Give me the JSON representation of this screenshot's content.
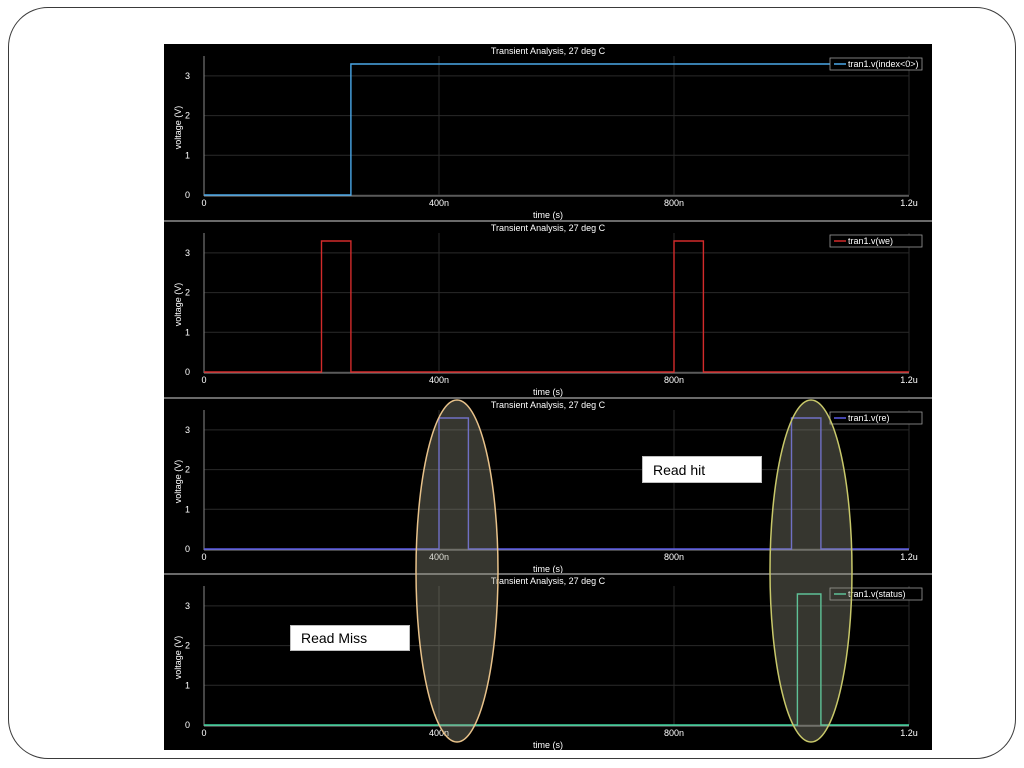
{
  "annotations": {
    "read_hit": "Read hit",
    "read_miss": "Read Miss"
  },
  "colors": {
    "background": "#000000",
    "grid": "#2a2a2a",
    "axis_text": "#ffffff",
    "highlight_outline": "#e8c28a",
    "highlight_fill": "#9a9a86"
  },
  "chart_data": [
    {
      "type": "line",
      "title": "Transient Analysis, 27 deg C",
      "xlabel": "time (s)",
      "ylabel": "voltage (V)",
      "xlim": [
        0,
        1200
      ],
      "ylim": [
        0,
        3.3
      ],
      "xticks": [
        {
          "v": 0,
          "l": "0"
        },
        {
          "v": 400,
          "l": "400n"
        },
        {
          "v": 800,
          "l": "800n"
        },
        {
          "v": 1200,
          "l": "1.2u"
        }
      ],
      "yticks": [
        0,
        1,
        2,
        3
      ],
      "legend_position": "top-right",
      "series": [
        {
          "name": "tran1.v(index<0>)",
          "color": "#4aa8e8",
          "x": [
            0,
            250,
            250,
            1200
          ],
          "y": [
            0,
            0,
            3.3,
            3.3
          ]
        }
      ]
    },
    {
      "type": "line",
      "title": "Transient Analysis, 27 deg C",
      "xlabel": "time (s)",
      "ylabel": "voltage (V)",
      "xlim": [
        0,
        1200
      ],
      "ylim": [
        0,
        3.3
      ],
      "xticks": [
        {
          "v": 0,
          "l": "0"
        },
        {
          "v": 400,
          "l": "400n"
        },
        {
          "v": 800,
          "l": "800n"
        },
        {
          "v": 1200,
          "l": "1.2u"
        }
      ],
      "yticks": [
        0,
        1,
        2,
        3
      ],
      "legend_position": "top-right",
      "series": [
        {
          "name": "tran1.v(we)",
          "color": "#d22b2b",
          "x": [
            0,
            200,
            200,
            250,
            250,
            800,
            800,
            850,
            850,
            1200
          ],
          "y": [
            0,
            0,
            3.3,
            3.3,
            0,
            0,
            3.3,
            3.3,
            0,
            0
          ]
        }
      ]
    },
    {
      "type": "line",
      "title": "Transient Analysis, 27 deg C",
      "xlabel": "time (s)",
      "ylabel": "voltage (V)",
      "xlim": [
        0,
        1200
      ],
      "ylim": [
        0,
        3.3
      ],
      "xticks": [
        {
          "v": 0,
          "l": "0"
        },
        {
          "v": 400,
          "l": "400n"
        },
        {
          "v": 800,
          "l": "800n"
        },
        {
          "v": 1200,
          "l": "1.2u"
        }
      ],
      "yticks": [
        0,
        1,
        2,
        3
      ],
      "legend_position": "top-right",
      "series": [
        {
          "name": "tran1.v(re)",
          "color": "#5a5ae6",
          "x": [
            0,
            400,
            400,
            450,
            450,
            1000,
            1000,
            1050,
            1050,
            1200
          ],
          "y": [
            0,
            0,
            3.3,
            3.3,
            0,
            0,
            3.3,
            3.3,
            0,
            0
          ]
        }
      ]
    },
    {
      "type": "line",
      "title": "Transient Analysis, 27 deg C",
      "xlabel": "time (s)",
      "ylabel": "voltage (V)",
      "xlim": [
        0,
        1200
      ],
      "ylim": [
        0,
        3.3
      ],
      "xticks": [
        {
          "v": 0,
          "l": "0"
        },
        {
          "v": 400,
          "l": "400n"
        },
        {
          "v": 800,
          "l": "800n"
        },
        {
          "v": 1200,
          "l": "1.2u"
        }
      ],
      "yticks": [
        0,
        1,
        2,
        3
      ],
      "legend_position": "top-right",
      "series": [
        {
          "name": "tran1.v(status)",
          "color": "#3fd6a0",
          "x": [
            0,
            1010,
            1010,
            1050,
            1050,
            1200
          ],
          "y": [
            0,
            0,
            3.3,
            3.3,
            0,
            0
          ]
        }
      ]
    }
  ]
}
